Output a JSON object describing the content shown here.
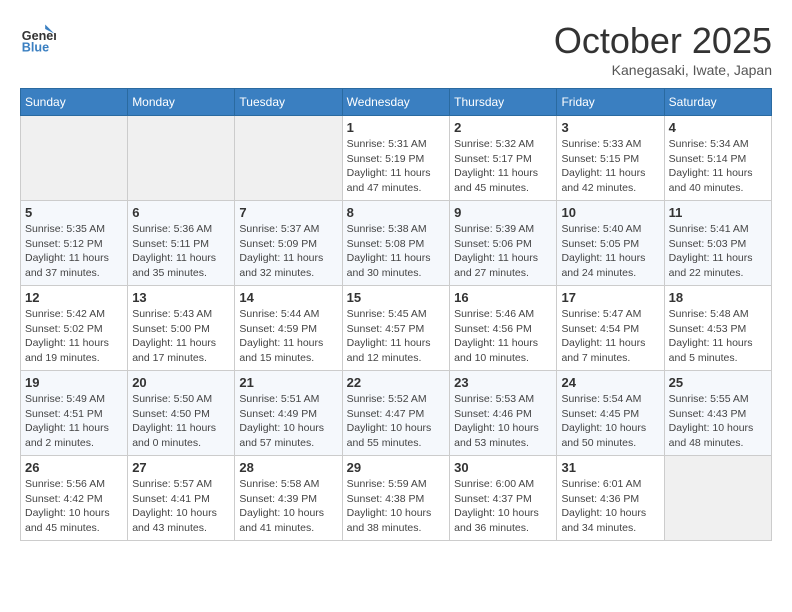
{
  "header": {
    "logo_line1": "General",
    "logo_line2": "Blue",
    "month": "October 2025",
    "location": "Kanegasaki, Iwate, Japan"
  },
  "weekdays": [
    "Sunday",
    "Monday",
    "Tuesday",
    "Wednesday",
    "Thursday",
    "Friday",
    "Saturday"
  ],
  "weeks": [
    [
      {
        "day": "",
        "info": ""
      },
      {
        "day": "",
        "info": ""
      },
      {
        "day": "",
        "info": ""
      },
      {
        "day": "1",
        "info": "Sunrise: 5:31 AM\nSunset: 5:19 PM\nDaylight: 11 hours\nand 47 minutes."
      },
      {
        "day": "2",
        "info": "Sunrise: 5:32 AM\nSunset: 5:17 PM\nDaylight: 11 hours\nand 45 minutes."
      },
      {
        "day": "3",
        "info": "Sunrise: 5:33 AM\nSunset: 5:15 PM\nDaylight: 11 hours\nand 42 minutes."
      },
      {
        "day": "4",
        "info": "Sunrise: 5:34 AM\nSunset: 5:14 PM\nDaylight: 11 hours\nand 40 minutes."
      }
    ],
    [
      {
        "day": "5",
        "info": "Sunrise: 5:35 AM\nSunset: 5:12 PM\nDaylight: 11 hours\nand 37 minutes."
      },
      {
        "day": "6",
        "info": "Sunrise: 5:36 AM\nSunset: 5:11 PM\nDaylight: 11 hours\nand 35 minutes."
      },
      {
        "day": "7",
        "info": "Sunrise: 5:37 AM\nSunset: 5:09 PM\nDaylight: 11 hours\nand 32 minutes."
      },
      {
        "day": "8",
        "info": "Sunrise: 5:38 AM\nSunset: 5:08 PM\nDaylight: 11 hours\nand 30 minutes."
      },
      {
        "day": "9",
        "info": "Sunrise: 5:39 AM\nSunset: 5:06 PM\nDaylight: 11 hours\nand 27 minutes."
      },
      {
        "day": "10",
        "info": "Sunrise: 5:40 AM\nSunset: 5:05 PM\nDaylight: 11 hours\nand 24 minutes."
      },
      {
        "day": "11",
        "info": "Sunrise: 5:41 AM\nSunset: 5:03 PM\nDaylight: 11 hours\nand 22 minutes."
      }
    ],
    [
      {
        "day": "12",
        "info": "Sunrise: 5:42 AM\nSunset: 5:02 PM\nDaylight: 11 hours\nand 19 minutes."
      },
      {
        "day": "13",
        "info": "Sunrise: 5:43 AM\nSunset: 5:00 PM\nDaylight: 11 hours\nand 17 minutes."
      },
      {
        "day": "14",
        "info": "Sunrise: 5:44 AM\nSunset: 4:59 PM\nDaylight: 11 hours\nand 15 minutes."
      },
      {
        "day": "15",
        "info": "Sunrise: 5:45 AM\nSunset: 4:57 PM\nDaylight: 11 hours\nand 12 minutes."
      },
      {
        "day": "16",
        "info": "Sunrise: 5:46 AM\nSunset: 4:56 PM\nDaylight: 11 hours\nand 10 minutes."
      },
      {
        "day": "17",
        "info": "Sunrise: 5:47 AM\nSunset: 4:54 PM\nDaylight: 11 hours\nand 7 minutes."
      },
      {
        "day": "18",
        "info": "Sunrise: 5:48 AM\nSunset: 4:53 PM\nDaylight: 11 hours\nand 5 minutes."
      }
    ],
    [
      {
        "day": "19",
        "info": "Sunrise: 5:49 AM\nSunset: 4:51 PM\nDaylight: 11 hours\nand 2 minutes."
      },
      {
        "day": "20",
        "info": "Sunrise: 5:50 AM\nSunset: 4:50 PM\nDaylight: 11 hours\nand 0 minutes."
      },
      {
        "day": "21",
        "info": "Sunrise: 5:51 AM\nSunset: 4:49 PM\nDaylight: 10 hours\nand 57 minutes."
      },
      {
        "day": "22",
        "info": "Sunrise: 5:52 AM\nSunset: 4:47 PM\nDaylight: 10 hours\nand 55 minutes."
      },
      {
        "day": "23",
        "info": "Sunrise: 5:53 AM\nSunset: 4:46 PM\nDaylight: 10 hours\nand 53 minutes."
      },
      {
        "day": "24",
        "info": "Sunrise: 5:54 AM\nSunset: 4:45 PM\nDaylight: 10 hours\nand 50 minutes."
      },
      {
        "day": "25",
        "info": "Sunrise: 5:55 AM\nSunset: 4:43 PM\nDaylight: 10 hours\nand 48 minutes."
      }
    ],
    [
      {
        "day": "26",
        "info": "Sunrise: 5:56 AM\nSunset: 4:42 PM\nDaylight: 10 hours\nand 45 minutes."
      },
      {
        "day": "27",
        "info": "Sunrise: 5:57 AM\nSunset: 4:41 PM\nDaylight: 10 hours\nand 43 minutes."
      },
      {
        "day": "28",
        "info": "Sunrise: 5:58 AM\nSunset: 4:39 PM\nDaylight: 10 hours\nand 41 minutes."
      },
      {
        "day": "29",
        "info": "Sunrise: 5:59 AM\nSunset: 4:38 PM\nDaylight: 10 hours\nand 38 minutes."
      },
      {
        "day": "30",
        "info": "Sunrise: 6:00 AM\nSunset: 4:37 PM\nDaylight: 10 hours\nand 36 minutes."
      },
      {
        "day": "31",
        "info": "Sunrise: 6:01 AM\nSunset: 4:36 PM\nDaylight: 10 hours\nand 34 minutes."
      },
      {
        "day": "",
        "info": ""
      }
    ]
  ]
}
